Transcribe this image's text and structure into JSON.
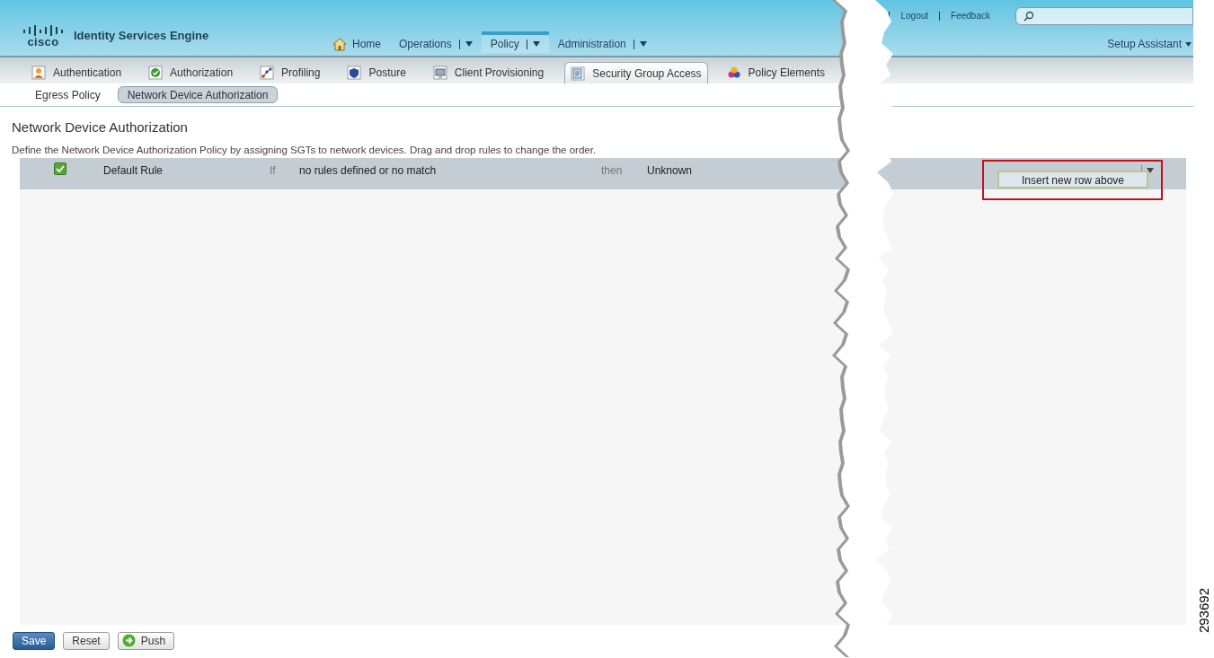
{
  "app": {
    "logo_text": "cisco",
    "title": "Identity Services Engine"
  },
  "top_links": [
    "Logout",
    "Feedback"
  ],
  "setup_assistant": "Setup Assistant",
  "nav": [
    {
      "label": "Home",
      "kind": "home",
      "selected": false
    },
    {
      "label": "Operations",
      "kind": "menu",
      "selected": false
    },
    {
      "label": "Policy",
      "kind": "menu",
      "selected": true
    },
    {
      "label": "Administration",
      "kind": "menu",
      "selected": false
    }
  ],
  "tabs": [
    {
      "label": "Authentication",
      "selected": false
    },
    {
      "label": "Authorization",
      "selected": false
    },
    {
      "label": "Profiling",
      "selected": false
    },
    {
      "label": "Posture",
      "selected": false
    },
    {
      "label": "Client Provisioning",
      "selected": false
    },
    {
      "label": "Security Group Access",
      "selected": true
    },
    {
      "label": "Policy Elements",
      "selected": false
    }
  ],
  "subtabs": [
    {
      "label": "Egress Policy",
      "selected": false
    },
    {
      "label": "Network Device Authorization",
      "selected": true
    }
  ],
  "page": {
    "title": "Network Device Authorization",
    "description": "Define the Network Device Authorization Policy by assigning SGTs to network devices. Drag and drop rules to change the order."
  },
  "rules": [
    {
      "enabled": true,
      "name": "Default Rule",
      "if": "If",
      "condition": "no rules defined or no match",
      "then": "then",
      "result": "Unknown"
    }
  ],
  "row_menu": {
    "items": [
      "Insert new row above"
    ]
  },
  "buttons": [
    {
      "label": "Save",
      "kind": "primary"
    },
    {
      "label": "Reset",
      "kind": "plain"
    },
    {
      "label": "Push",
      "kind": "push"
    }
  ],
  "figure_id": "293692"
}
